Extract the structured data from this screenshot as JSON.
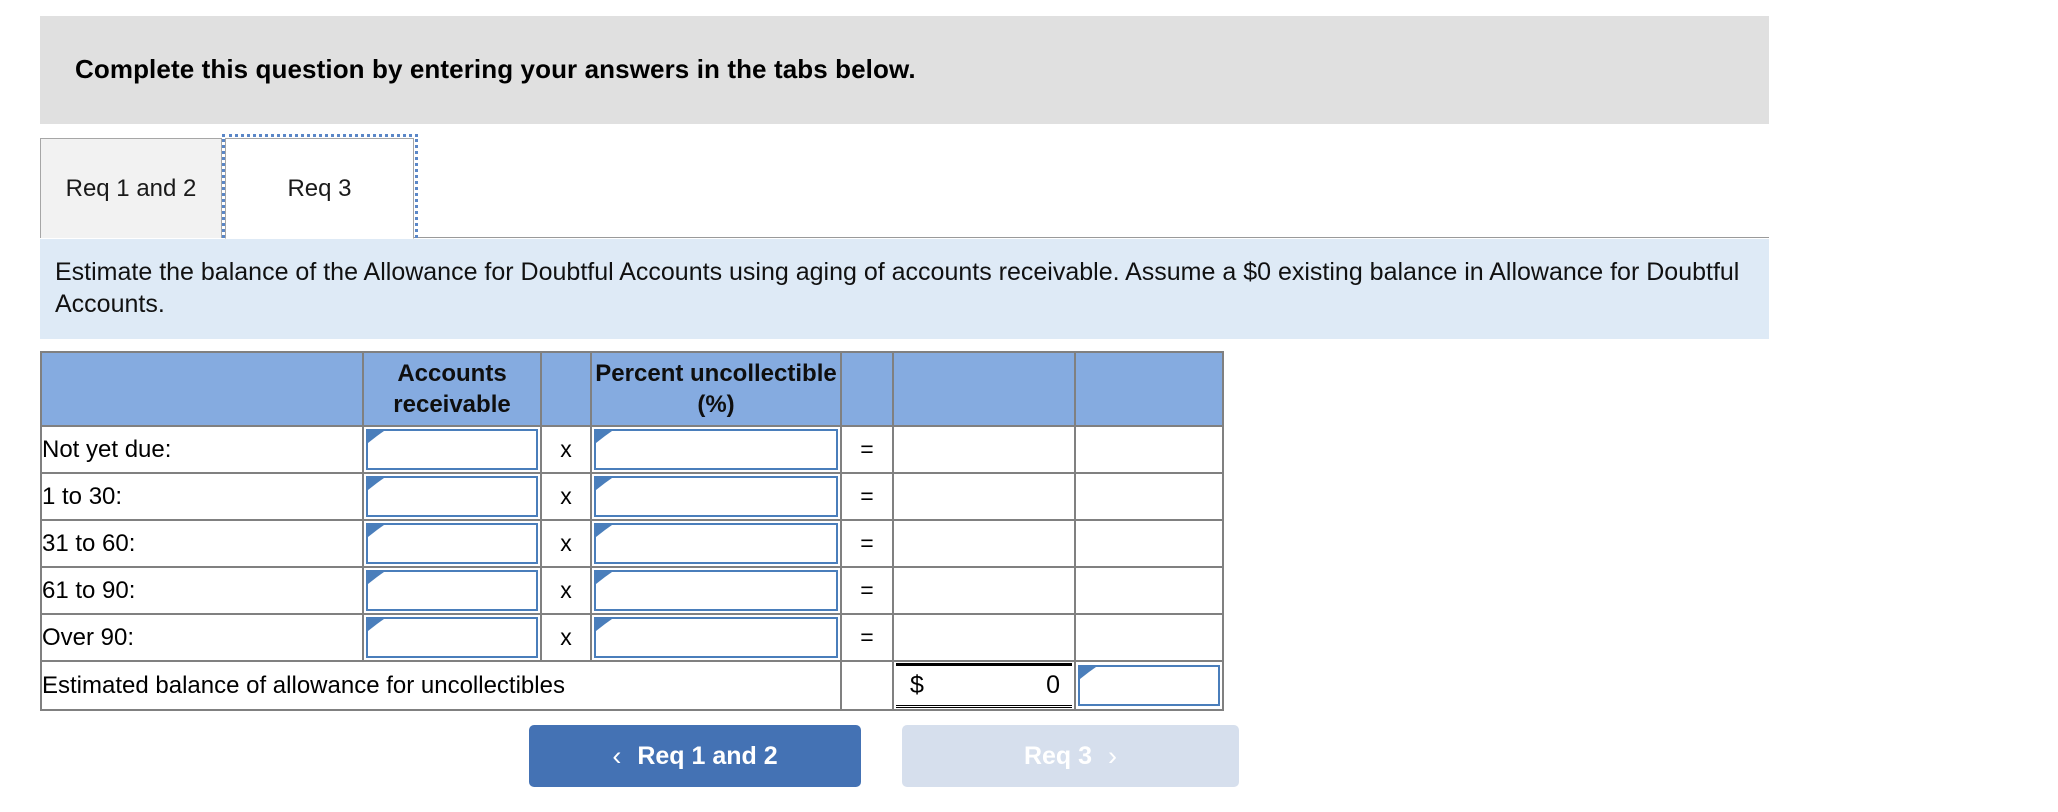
{
  "banner": {
    "text": "Complete this question by entering your answers in the tabs below."
  },
  "tabs": {
    "items": [
      {
        "label": "Req 1 and 2",
        "active": false
      },
      {
        "label": "Req 3",
        "active": true
      }
    ]
  },
  "instruction": {
    "text": "Estimate the balance of the Allowance for Doubtful Accounts using aging of accounts receivable. Assume a $0 existing balance in Allowance for Doubtful Accounts."
  },
  "table": {
    "headers": {
      "label": "",
      "accounts_receivable": "Accounts receivable",
      "operator": "",
      "percent_uncollectible": "Percent uncollectible (%)",
      "equals": "",
      "result": "",
      "extra": ""
    },
    "multiply_symbol": "x",
    "equals_symbol": "=",
    "rows": [
      {
        "label": "Not yet due:",
        "accounts_receivable": "",
        "percent_uncollectible": "",
        "result": "",
        "extra": ""
      },
      {
        "label": "1 to 30:",
        "accounts_receivable": "",
        "percent_uncollectible": "",
        "result": "",
        "extra": ""
      },
      {
        "label": "31 to 60:",
        "accounts_receivable": "",
        "percent_uncollectible": "",
        "result": "",
        "extra": ""
      },
      {
        "label": "61 to 90:",
        "accounts_receivable": "",
        "percent_uncollectible": "",
        "result": "",
        "extra": ""
      },
      {
        "label": "Over 90:",
        "accounts_receivable": "",
        "percent_uncollectible": "",
        "result": "",
        "extra": ""
      }
    ],
    "totals": {
      "label": "Estimated balance of allowance for uncollectibles",
      "currency": "$",
      "value": "0",
      "extra": ""
    }
  },
  "nav": {
    "prev_label": "Req 1 and 2",
    "prev_chevron": "‹",
    "next_label": "Req 3",
    "next_chevron": "›"
  },
  "colors": {
    "banner_bg": "#e0e0e0",
    "instruction_bg": "#deeaf6",
    "header_blue": "#85abe0",
    "input_border": "#4a7ebb",
    "button_primary": "#4472b4",
    "button_disabled": "#d6dfed",
    "grid_line": "#808080"
  }
}
